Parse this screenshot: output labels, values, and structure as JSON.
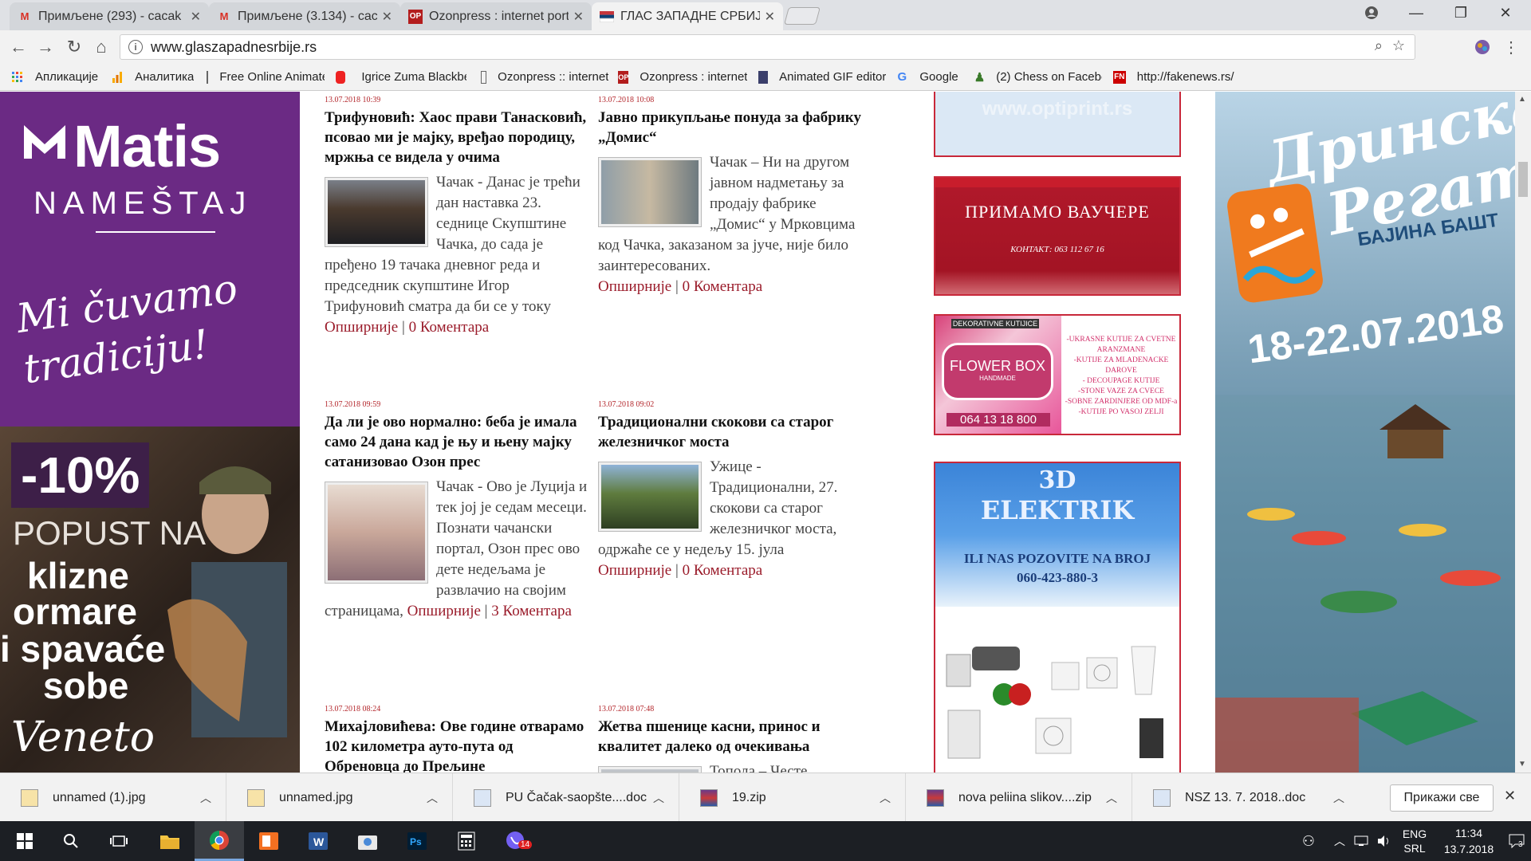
{
  "browser": {
    "tabs": [
      {
        "title": "Примљене (293) - cacak",
        "icon": "gmail-icon",
        "active": false
      },
      {
        "title": "Примљене (3.134) - caca",
        "icon": "gmail-icon",
        "active": false
      },
      {
        "title": "Ozonpress : internet port",
        "icon": "ozonpress-icon",
        "active": false
      },
      {
        "title": "ГЛАС ЗАПАДНЕ СРБИЈЕ",
        "icon": "flag-icon",
        "active": true
      }
    ],
    "url": "www.glaszapadnesrbije.rs",
    "bookmarks": [
      {
        "label": "Апликације",
        "icon": "apps-grid-icon"
      },
      {
        "label": "Аналитика",
        "icon": "analytics-icon"
      },
      {
        "label": "Free Online Animate",
        "icon": "page-icon"
      },
      {
        "label": "",
        "icon": "red-app-icon"
      },
      {
        "label": "Igrice Zuma Blackbe",
        "icon": ""
      },
      {
        "label": "Ozonpress :: internet",
        "icon": "page-icon"
      },
      {
        "label": "Ozonpress : internet",
        "icon": "ozonpress-icon"
      },
      {
        "label": "Animated GIF editor",
        "icon": "gif-icon"
      },
      {
        "label": "Google",
        "icon": "google-icon"
      },
      {
        "label": "(2) Chess on Facebo",
        "icon": "chess-icon"
      },
      {
        "label": "http://fakenews.rs/",
        "icon": "fn-icon"
      }
    ]
  },
  "ads": {
    "left": {
      "brand": "Matis",
      "sub": "NAMEŠTAJ",
      "slogan": "Mi čuvamo tradiciju!",
      "discount": "-10%",
      "promo1": "POPUST NA",
      "promo2": "klizne",
      "promo3": "ormare",
      "promo4": "i spavaće",
      "promo5": "sobe",
      "signature": "Veneto"
    },
    "right": {
      "title1": "Дринска",
      "title2": "Регата",
      "place": "БАЈИНА БАШТ",
      "dates": "18-22.07.2018"
    },
    "sidebar": {
      "top_text": "www.optiprint.rs",
      "voucher_title": "ПРИМАМО ВАУЧЕРЕ",
      "voucher_contact": "КОНТАКТ: 063 112 67 16",
      "flower_header": "DEKORATIVNE KUTIJICE",
      "flower_brand": "FLOWER BOX",
      "flower_sub": "HANDMADE",
      "flower_phone": "064 13 18 800",
      "flower_list": [
        "-UKRASNE KUTIJE ZA CVETNE ARANZMANE",
        "-KUTIJE ZA MLADENACKE DAROVE",
        "- DECOUPAGE KUTIJE",
        "-STONE VAZE ZA CVECE",
        "-SOBNE ZARDINJERE OD MDF-a",
        "-KUTIJE PO VASOJ ZELJI"
      ],
      "elektrik_3d": "3D",
      "elektrik_name": "ELEKTRIK",
      "elektrik_call": "ILI NAS POZOVITE NA BROJ",
      "elektrik_phone": "060-423-880-3"
    }
  },
  "articles": [
    {
      "date": "13.07.2018 10:39",
      "title": "Трифуновић: Хаос прави Танасковић, псовао ми је мајку, вређао породицу, мржња се видела у очима",
      "body": "Чачак - Данас је трећи дан наставка 23. седнице Скупштине Чачка, до сада је пређено 19 тачака дневног реда и председник скупштине Игор Трифуновић сматра да би се у току",
      "more": "Опширније",
      "sep": " | ",
      "comments": "0 Коментара"
    },
    {
      "date": "13.07.2018 10:08",
      "title": "Јавно прикупљање понуда за фабрику „Домис“",
      "body": "Чачак – Ни на другом јавном надметању за продају фабрике „Домис“ у Мрковцима код Чачка, заказаном за јуче, није било заинтересованих.",
      "more": "Опширније",
      "sep": " | ",
      "comments": "0 Коментара"
    },
    {
      "date": "13.07.2018 09:59",
      "title": "Да ли је ово нормално: беба је имала само 24 дана кад је њу и њену мајку сатанизовао Озон прес",
      "body": "Чачак - Ово је Луција и тек јој је седам месеци. Познати чачански портал, Озон прес ово дете недељама је развлачио на својим страницама,",
      "more": "Опширније",
      "sep": " | ",
      "comments": "3 Коментара"
    },
    {
      "date": "13.07.2018 09:02",
      "title": "Традиционални скокови са старог железничког моста",
      "body": "Ужице - Традиционални, 27. скокови са старог железничког моста, одржаће се у недељу 15. јула",
      "more": "Опширније",
      "sep": " | ",
      "comments": "0 Коментара"
    },
    {
      "date": "13.07.2018 08:24",
      "title": "Михајловићева: Ове године отварамо 102 километра ауто-пута од Обреновца до Прељине",
      "body": "",
      "more": "",
      "sep": "",
      "comments": ""
    },
    {
      "date": "13.07.2018 07:48",
      "title": "Жетва пшенице касни, принос и квалитет далеко од очекивања",
      "body": "Топола – Честе",
      "more": "",
      "sep": "",
      "comments": ""
    }
  ],
  "downloads": {
    "items": [
      {
        "name": "unnamed (1).jpg",
        "icon": "image-file-icon"
      },
      {
        "name": "unnamed.jpg",
        "icon": "image-file-icon"
      },
      {
        "name": "PU Čačak-saopšte....doc",
        "icon": "doc-file-icon"
      },
      {
        "name": "19.zip",
        "icon": "zip-file-icon"
      },
      {
        "name": "nova peliina slikov....zip",
        "icon": "zip-file-icon"
      },
      {
        "name": "NSZ 13. 7. 2018..doc",
        "icon": "doc-file-icon"
      }
    ],
    "show_all": "Прикажи све"
  },
  "taskbar": {
    "lang_top": "ENG",
    "lang_bottom": "SRL",
    "time": "11:34",
    "date": "13.7.2018",
    "notifications": "3",
    "viber_badge": "14"
  },
  "colors": {
    "accent_red": "#9a1b2a",
    "date_red": "#b3262b",
    "matis_purple": "#6b2a84",
    "taskbar": "#1c1f24"
  }
}
